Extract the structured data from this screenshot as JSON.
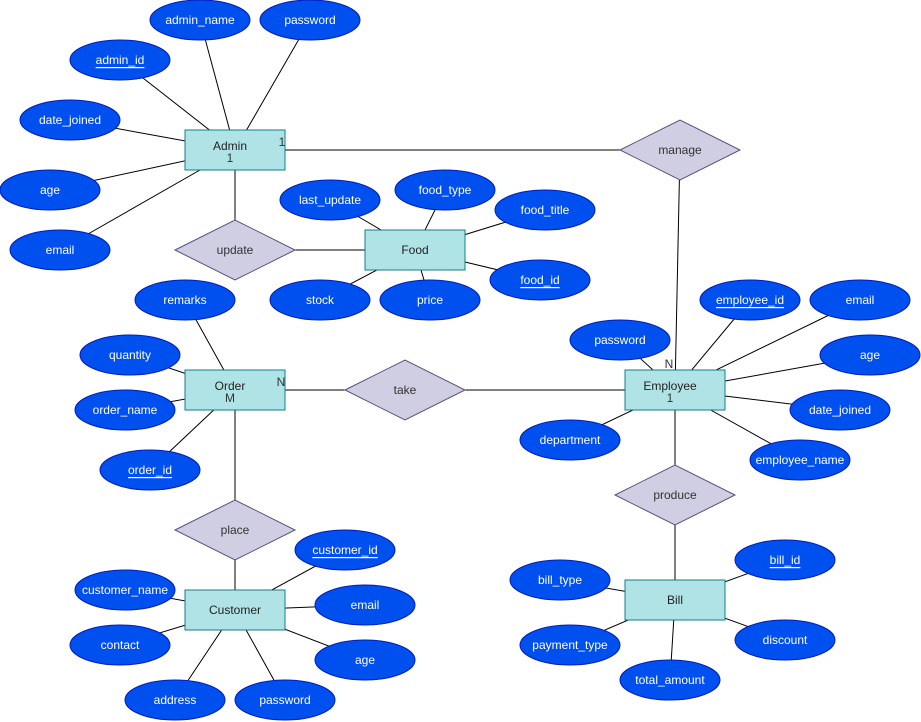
{
  "colors": {
    "attribute_fill": "#0050ef",
    "attribute_stroke": "#001dbc",
    "entity_fill": "#b0e3e6",
    "entity_stroke": "#0e8088",
    "relationship_fill": "#d0cee2",
    "relationship_stroke": "#56517e",
    "line": "#000000"
  },
  "entities": [
    {
      "id": "admin",
      "label": "Admin",
      "sublabel": "1"
    },
    {
      "id": "food",
      "label": "Food",
      "sublabel": ""
    },
    {
      "id": "order",
      "label": "Order",
      "sublabel": "M"
    },
    {
      "id": "customer",
      "label": "Customer",
      "sublabel": ""
    },
    {
      "id": "employee",
      "label": "Employee",
      "sublabel": "1"
    },
    {
      "id": "bill",
      "label": "Bill",
      "sublabel": ""
    }
  ],
  "relationships": [
    {
      "id": "manage",
      "label": "manage"
    },
    {
      "id": "update",
      "label": "update"
    },
    {
      "id": "take",
      "label": "take"
    },
    {
      "id": "place",
      "label": "place"
    },
    {
      "id": "produce",
      "label": "produce"
    }
  ],
  "attributes": [
    {
      "id": "a_name",
      "entity": "admin",
      "label": "admin_name",
      "key": false
    },
    {
      "id": "a_pw",
      "entity": "admin",
      "label": "password",
      "key": false
    },
    {
      "id": "a_id",
      "entity": "admin",
      "label": "admin_id",
      "key": true
    },
    {
      "id": "a_dj",
      "entity": "admin",
      "label": "date_joined",
      "key": false
    },
    {
      "id": "a_age",
      "entity": "admin",
      "label": "age",
      "key": false
    },
    {
      "id": "a_email",
      "entity": "admin",
      "label": "email",
      "key": false
    },
    {
      "id": "f_lu",
      "entity": "food",
      "label": "last_update",
      "key": false
    },
    {
      "id": "f_type",
      "entity": "food",
      "label": "food_type",
      "key": false
    },
    {
      "id": "f_title",
      "entity": "food",
      "label": "food_title",
      "key": false
    },
    {
      "id": "f_id",
      "entity": "food",
      "label": "food_id",
      "key": true
    },
    {
      "id": "f_stock",
      "entity": "food",
      "label": "stock",
      "key": false
    },
    {
      "id": "f_price",
      "entity": "food",
      "label": "price",
      "key": false
    },
    {
      "id": "o_rem",
      "entity": "order",
      "label": "remarks",
      "key": false
    },
    {
      "id": "o_qty",
      "entity": "order",
      "label": "quantity",
      "key": false
    },
    {
      "id": "o_name",
      "entity": "order",
      "label": "order_name",
      "key": false
    },
    {
      "id": "o_id",
      "entity": "order",
      "label": "order_id",
      "key": true
    },
    {
      "id": "c_id",
      "entity": "customer",
      "label": "customer_id",
      "key": true
    },
    {
      "id": "c_name",
      "entity": "customer",
      "label": "customer_name",
      "key": false
    },
    {
      "id": "c_email",
      "entity": "customer",
      "label": "email",
      "key": false
    },
    {
      "id": "c_contact",
      "entity": "customer",
      "label": "contact",
      "key": false
    },
    {
      "id": "c_age",
      "entity": "customer",
      "label": "age",
      "key": false
    },
    {
      "id": "c_addr",
      "entity": "customer",
      "label": "address",
      "key": false
    },
    {
      "id": "c_pw",
      "entity": "customer",
      "label": "password",
      "key": false
    },
    {
      "id": "e_pw",
      "entity": "employee",
      "label": "password",
      "key": false
    },
    {
      "id": "e_id",
      "entity": "employee",
      "label": "employee_id",
      "key": true
    },
    {
      "id": "e_email",
      "entity": "employee",
      "label": "email",
      "key": false
    },
    {
      "id": "e_age",
      "entity": "employee",
      "label": "age",
      "key": false
    },
    {
      "id": "e_dj",
      "entity": "employee",
      "label": "date_joined",
      "key": false
    },
    {
      "id": "e_dept",
      "entity": "employee",
      "label": "department",
      "key": false
    },
    {
      "id": "e_name",
      "entity": "employee",
      "label": "employee_name",
      "key": false
    },
    {
      "id": "b_type",
      "entity": "bill",
      "label": "bill_type",
      "key": false
    },
    {
      "id": "b_id",
      "entity": "bill",
      "label": "bill_id",
      "key": true
    },
    {
      "id": "b_pay",
      "entity": "bill",
      "label": "payment_type",
      "key": false
    },
    {
      "id": "b_disc",
      "entity": "bill",
      "label": "discount",
      "key": false
    },
    {
      "id": "b_total",
      "entity": "bill",
      "label": "total_amount",
      "key": false
    }
  ],
  "links": [
    {
      "from": "admin",
      "to": "manage",
      "cardinality": "1"
    },
    {
      "from": "manage",
      "to": "employee",
      "cardinality": "N"
    },
    {
      "from": "admin",
      "to": "update",
      "cardinality": ""
    },
    {
      "from": "update",
      "to": "food",
      "cardinality": ""
    },
    {
      "from": "order",
      "to": "take",
      "cardinality": "N"
    },
    {
      "from": "take",
      "to": "employee",
      "cardinality": ""
    },
    {
      "from": "order",
      "to": "place",
      "cardinality": ""
    },
    {
      "from": "place",
      "to": "customer",
      "cardinality": ""
    },
    {
      "from": "employee",
      "to": "produce",
      "cardinality": ""
    },
    {
      "from": "produce",
      "to": "bill",
      "cardinality": ""
    }
  ]
}
